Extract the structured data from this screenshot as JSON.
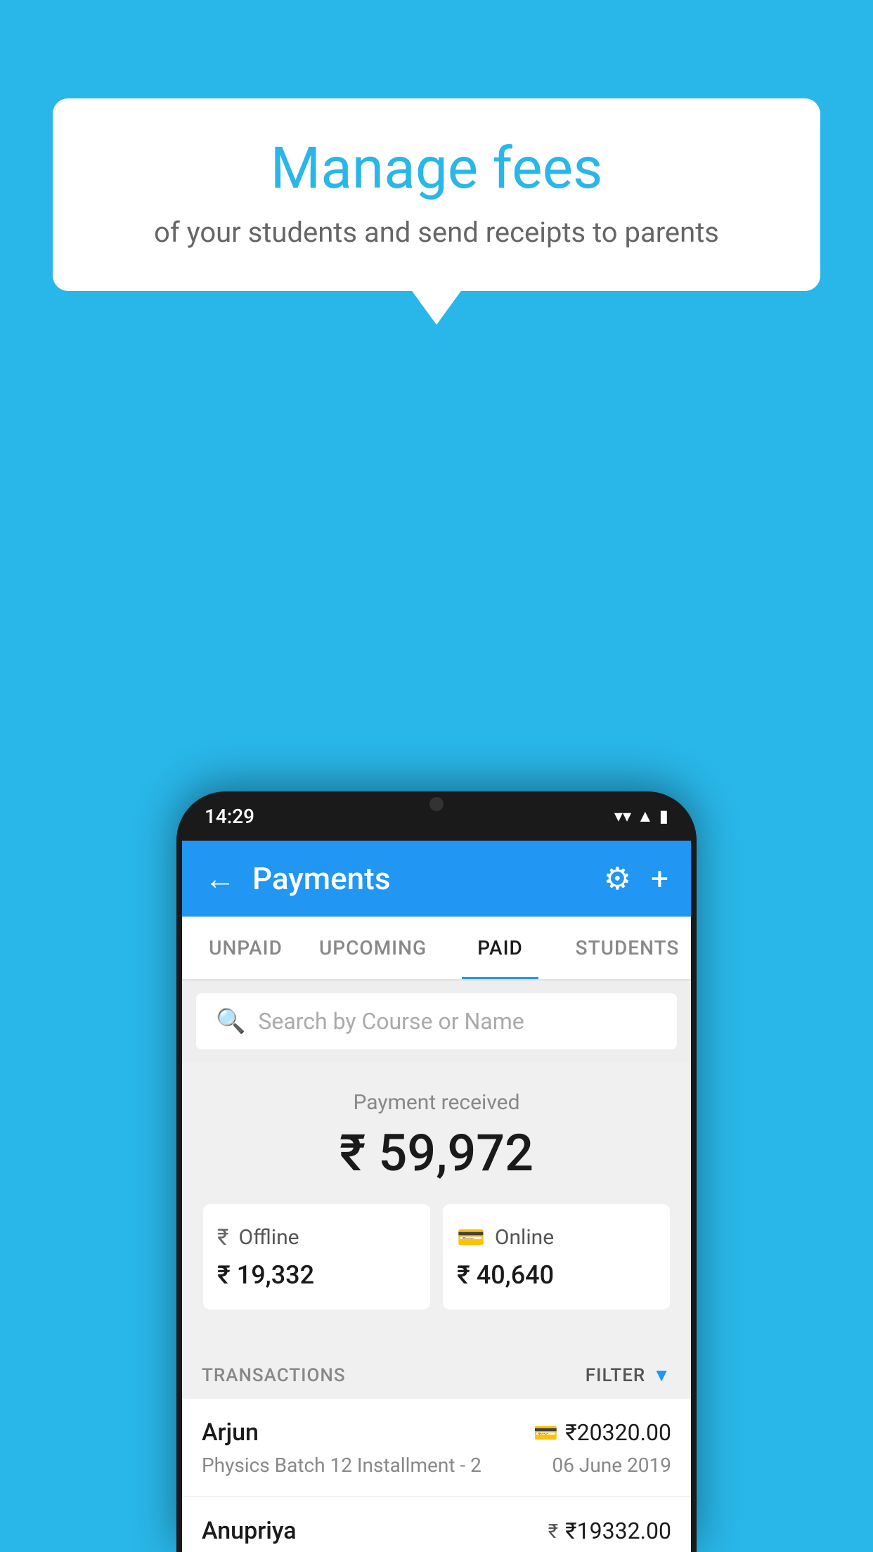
{
  "background_color": "#29b6e8",
  "speech_bubble": {
    "title": "Manage fees",
    "subtitle": "of your students and send receipts to parents"
  },
  "phone": {
    "status_bar": {
      "time": "14:29"
    },
    "header": {
      "title": "Payments",
      "back_label": "←",
      "settings_label": "⚙",
      "add_label": "+"
    },
    "tabs": [
      {
        "label": "UNPAID",
        "active": false
      },
      {
        "label": "UPCOMING",
        "active": false
      },
      {
        "label": "PAID",
        "active": true
      },
      {
        "label": "STUDENTS",
        "active": false
      }
    ],
    "search": {
      "placeholder": "Search by Course or Name"
    },
    "payment_received": {
      "label": "Payment received",
      "total": "₹ 59,972",
      "offline": {
        "label": "Offline",
        "amount": "₹ 19,332"
      },
      "online": {
        "label": "Online",
        "amount": "₹ 40,640"
      }
    },
    "transactions": {
      "header": "TRANSACTIONS",
      "filter": "FILTER",
      "rows": [
        {
          "name": "Arjun",
          "course": "Physics Batch 12 Installment - 2",
          "amount": "₹20320.00",
          "date": "06 June 2019",
          "payment_type": "card"
        },
        {
          "name": "Anupriya",
          "amount": "₹19332.00",
          "payment_type": "rupee"
        }
      ]
    }
  }
}
